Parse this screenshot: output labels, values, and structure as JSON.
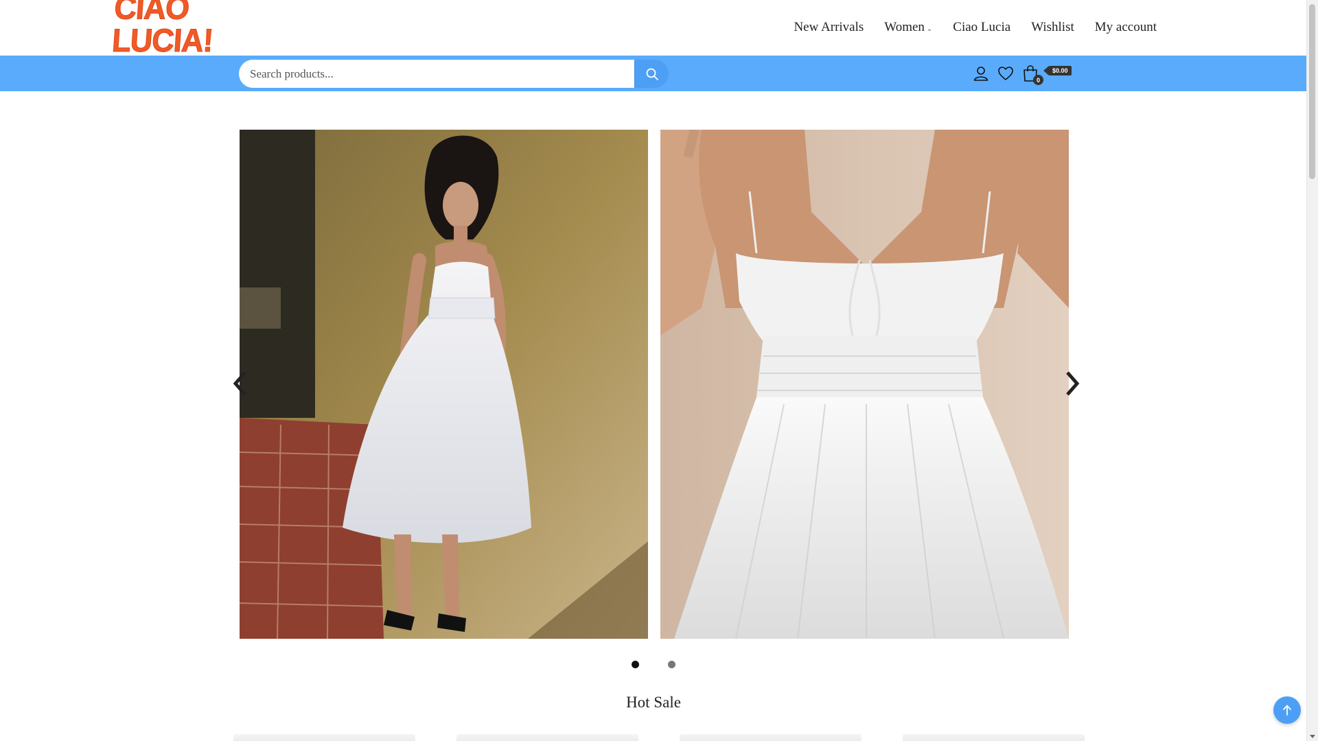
{
  "brand": {
    "logo_text": "CIAO LUCIA!",
    "logo_color": "#f05a28"
  },
  "nav": {
    "items": [
      {
        "label": "New Arrivals",
        "has_dropdown": false
      },
      {
        "label": "Women",
        "has_dropdown": true
      },
      {
        "label": "Ciao Lucia",
        "has_dropdown": false
      },
      {
        "label": "Wishlist",
        "has_dropdown": false
      },
      {
        "label": "My account",
        "has_dropdown": false
      }
    ]
  },
  "search": {
    "placeholder": "Search products...",
    "value": ""
  },
  "header_icons": {
    "account": "user-icon",
    "wishlist": "heart-icon",
    "cart": "shopping-bag-icon"
  },
  "cart": {
    "count": "0",
    "total": "$0.00"
  },
  "hero": {
    "slides": [
      {
        "alt": "woman in white dress",
        "active": true
      },
      {
        "alt": "white dress close-up",
        "active": false
      }
    ]
  },
  "sections": {
    "hot_sale_title": "Hot Sale"
  },
  "colors": {
    "accent_blue": "#5aabfb",
    "button_blue": "#4d9ff5"
  }
}
